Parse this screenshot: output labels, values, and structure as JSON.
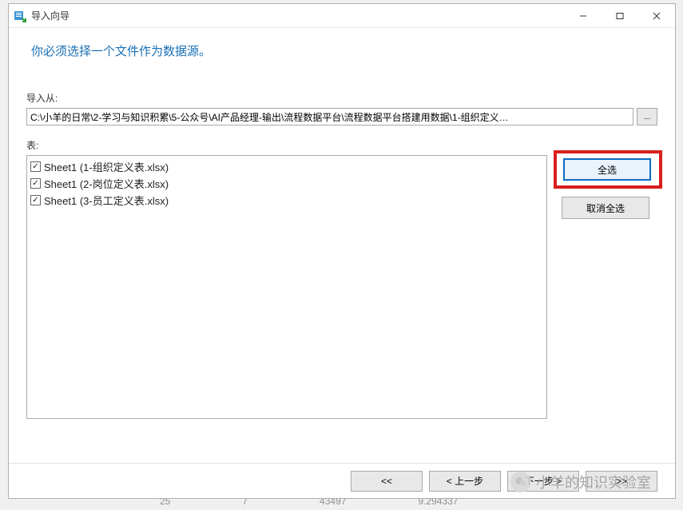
{
  "window": {
    "title": "导入向导"
  },
  "headline": "你必须选择一个文件作为数据源。",
  "importFrom": {
    "label": "导入从:",
    "value": "C:\\小羊的日常\\2-学习与知识积累\\5-公众号\\AI产品经理-输出\\流程数据平台\\流程数据平台搭建用数据\\1-组织定义…",
    "browse": "..."
  },
  "tables": {
    "label": "表:",
    "items": [
      {
        "checked": true,
        "label": "Sheet1 (1-组织定义表.xlsx)"
      },
      {
        "checked": true,
        "label": "Sheet1 (2-岗位定义表.xlsx)"
      },
      {
        "checked": true,
        "label": "Sheet1 (3-员工定义表.xlsx)"
      }
    ]
  },
  "sideButtons": {
    "selectAll": "全选",
    "deselectAll": "取消全选"
  },
  "footer": {
    "first": "<<",
    "prev": "< 上一步",
    "next": "下一步 >",
    "last": ">>"
  },
  "watermark": "小羊的知识实验室",
  "bgCells": [
    "25",
    "7",
    "43497",
    "9.294337"
  ]
}
